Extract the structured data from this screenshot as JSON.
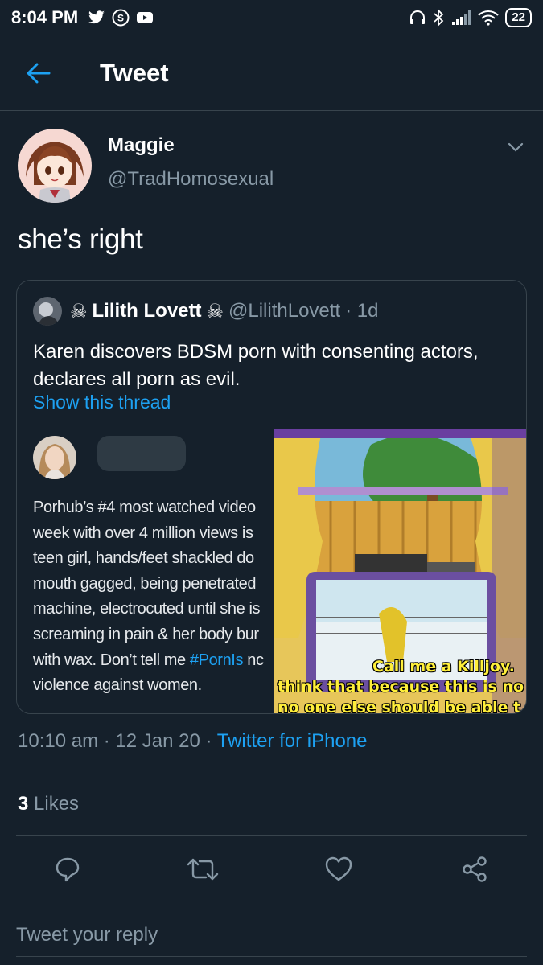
{
  "status_bar": {
    "time": "8:04 PM",
    "battery": "22",
    "left_icons": [
      "twitter-bird-icon",
      "skype-icon",
      "youtube-icon"
    ],
    "right_icons": [
      "headphones-icon",
      "bluetooth-icon",
      "signal-icon",
      "wifi-icon",
      "battery-icon"
    ]
  },
  "header": {
    "title": "Tweet",
    "back_icon": "arrow-left-icon"
  },
  "author": {
    "name": "Maggie",
    "handle": "@TradHomosexual"
  },
  "tweet": {
    "text": "she’s right"
  },
  "quoted": {
    "name": "Lilith Lovett",
    "name_emoji_left": "☠",
    "name_emoji_right": "☠",
    "handle": "@LilithLovett",
    "age": "· 1d",
    "text": "Karen discovers BDSM porn with consenting actors, declares all porn as evil.",
    "show_thread": "Show this thread",
    "inner_lines": [
      "Porhub’s #4 most watched video",
      "week with over 4 million views is",
      "teen girl, hands/feet shackled do",
      "mouth gagged, being penetrated",
      "machine, electrocuted until she is",
      "screaming in pain & her body bur",
      "with wax. Don’t tell me ",
      "violence against women."
    ],
    "inner_hashtag": "#PornIs",
    "inner_hashtag_tail": " nc",
    "meme_caption_1": "Call me a Killjoy.",
    "meme_caption_2": "think that because this is no",
    "meme_caption_3": "no one else should be able t"
  },
  "meta": {
    "time": "10:10 am",
    "sep1": " · ",
    "date": "12 Jan 20",
    "sep2": " · ",
    "client": "Twitter for iPhone"
  },
  "likes": {
    "count": "3",
    "label": " Likes"
  },
  "actions": [
    "reply-icon",
    "retweet-icon",
    "like-icon",
    "share-icon"
  ],
  "reply": {
    "placeholder": "Tweet your reply"
  },
  "colors": {
    "background": "#15202b",
    "accent": "#1da1f2",
    "secondary_text": "#8899a6",
    "divider": "#38444d"
  }
}
